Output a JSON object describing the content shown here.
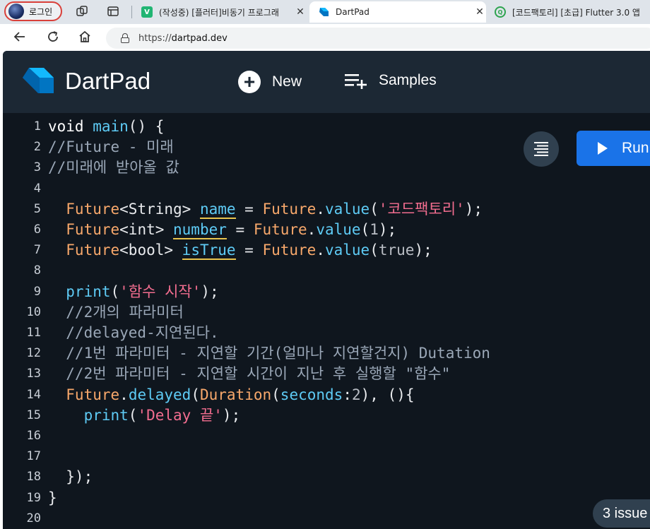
{
  "browser": {
    "profile_label": "로그인",
    "tabs": [
      {
        "title": "(작성중) [플러터]비동기 프로그래",
        "favicon": "V",
        "favicon_color": "#21b573"
      },
      {
        "title": "DartPad",
        "favicon": "",
        "favicon_color": "#1a73e8"
      },
      {
        "title": "[코드팩토리] [초급] Flutter 3.0 앱",
        "favicon": "Q",
        "favicon_color": "#2ea44f"
      }
    ],
    "url_prefix": "https://",
    "url_host": "dartpad.dev"
  },
  "dartpad": {
    "brand": "DartPad",
    "new_label": "New",
    "samples_label": "Samples",
    "run_label": "Run",
    "issues_label": "3 issue"
  },
  "editor": {
    "line_numbers": [
      "1",
      "2",
      "3",
      "4",
      "5",
      "6",
      "7",
      "8",
      "9",
      "10",
      "11",
      "12",
      "13",
      "14",
      "15",
      "16",
      "17",
      "18",
      "19",
      "20"
    ],
    "lines": [
      [
        [
          "kw",
          "void "
        ],
        [
          "fn",
          "main"
        ],
        [
          "pr",
          "() {"
        ]
      ],
      [
        [
          "cm",
          "//Future - 미래"
        ]
      ],
      [
        [
          "cm",
          "//미래에 받아올 값"
        ]
      ],
      [],
      [
        [
          "ty",
          "  Future"
        ],
        [
          "pr",
          "<String> "
        ],
        [
          "prop",
          "name"
        ],
        [
          "pr",
          " = "
        ],
        [
          "ty",
          "Future"
        ],
        [
          "pr",
          "."
        ],
        [
          "fn",
          "value"
        ],
        [
          "pr",
          "("
        ],
        [
          "st",
          "'코드팩토리'"
        ],
        [
          "pr",
          ");"
        ]
      ],
      [
        [
          "ty",
          "  Future"
        ],
        [
          "pr",
          "<int> "
        ],
        [
          "prop",
          "number"
        ],
        [
          "pr",
          " = "
        ],
        [
          "ty",
          "Future"
        ],
        [
          "pr",
          "."
        ],
        [
          "fn",
          "value"
        ],
        [
          "pr",
          "("
        ],
        [
          "nm",
          "1"
        ],
        [
          "pr",
          ");"
        ]
      ],
      [
        [
          "ty",
          "  Future"
        ],
        [
          "pr",
          "<bool> "
        ],
        [
          "prop",
          "isTrue"
        ],
        [
          "pr",
          " = "
        ],
        [
          "ty",
          "Future"
        ],
        [
          "pr",
          "."
        ],
        [
          "fn",
          "value"
        ],
        [
          "pr",
          "("
        ],
        [
          "nm",
          "true"
        ],
        [
          "pr",
          ");"
        ]
      ],
      [],
      [
        [
          "fn",
          "  print"
        ],
        [
          "pr",
          "("
        ],
        [
          "st",
          "'함수 시작'"
        ],
        [
          "pr",
          ");"
        ]
      ],
      [
        [
          "cm",
          "  //2개의 파라미터"
        ]
      ],
      [
        [
          "cm",
          "  //delayed-지연된다."
        ]
      ],
      [
        [
          "cm",
          "  //1번 파라미터 - 지연할 기간(얼마나 지연할건지) Dutation"
        ]
      ],
      [
        [
          "cm",
          "  //2번 파라미터 - 지연할 시간이 지난 후 실행할 \"함수\""
        ]
      ],
      [
        [
          "ty",
          "  Future"
        ],
        [
          "pr",
          "."
        ],
        [
          "fn",
          "delayed"
        ],
        [
          "pr",
          "("
        ],
        [
          "ty",
          "Duration"
        ],
        [
          "pr",
          "("
        ],
        [
          "fn",
          "seconds"
        ],
        [
          "pr",
          ":"
        ],
        [
          "nm",
          "2"
        ],
        [
          "pr",
          "), (){"
        ]
      ],
      [
        [
          "fn",
          "    print"
        ],
        [
          "pr",
          "("
        ],
        [
          "st",
          "'Delay 끝'"
        ],
        [
          "pr",
          ");"
        ]
      ],
      [],
      [],
      [
        [
          "pr",
          "  });"
        ]
      ],
      [
        [
          "pr",
          "}"
        ]
      ],
      []
    ]
  }
}
